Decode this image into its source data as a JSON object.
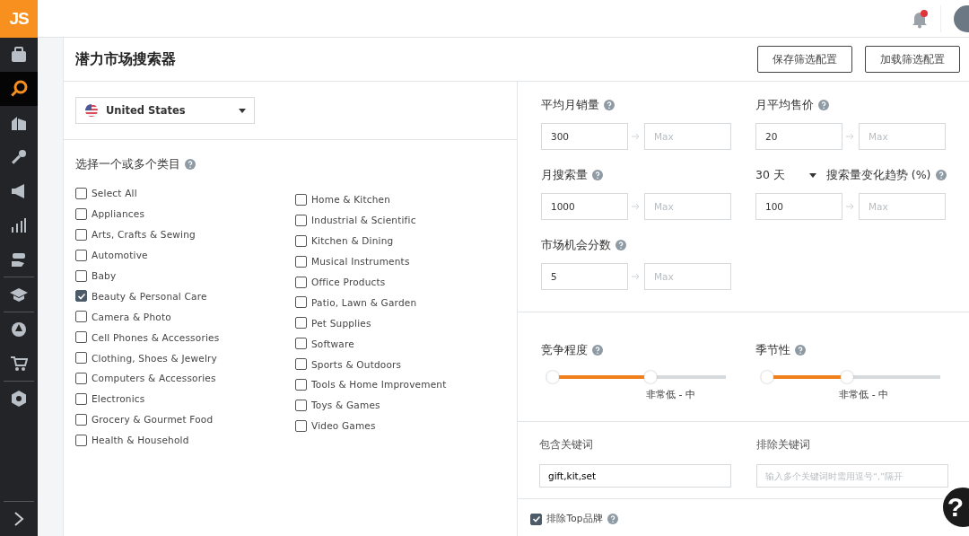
{
  "logo": "JS",
  "sidebar": {
    "items": [
      {
        "kind": "toolbox",
        "selected": false
      },
      {
        "kind": "search",
        "selected": true
      },
      {
        "kind": "building",
        "selected": false
      },
      {
        "kind": "key",
        "selected": false
      },
      {
        "kind": "megaphone",
        "selected": false
      },
      {
        "kind": "chart",
        "selected": false
      },
      {
        "kind": "hand",
        "selected": false
      },
      {
        "kind": "cap",
        "selected": false
      },
      {
        "kind": "aperture",
        "selected": false
      },
      {
        "kind": "cart",
        "selected": false
      },
      {
        "kind": "gear",
        "selected": false
      }
    ]
  },
  "notifications": {
    "unread": true
  },
  "header": {
    "title": "潜力市场搜索器",
    "buttons": [
      "保存筛选配置",
      "加载筛选配置"
    ]
  },
  "country": {
    "value": "United States"
  },
  "categories": {
    "heading": "选择一个或多个类目",
    "columns": [
      [
        {
          "label": "Select All",
          "checked": false
        },
        {
          "label": "Appliances",
          "checked": false
        },
        {
          "label": "Arts, Crafts & Sewing",
          "checked": false
        },
        {
          "label": "Automotive",
          "checked": false
        },
        {
          "label": "Baby",
          "checked": false
        },
        {
          "label": "Beauty & Personal Care",
          "checked": true
        },
        {
          "label": "Camera & Photo",
          "checked": false
        },
        {
          "label": "Cell Phones & Accessories",
          "checked": false
        },
        {
          "label": "Clothing, Shoes & Jewelry",
          "checked": false
        },
        {
          "label": "Computers & Accessories",
          "checked": false
        },
        {
          "label": "Electronics",
          "checked": false
        },
        {
          "label": "Grocery & Gourmet Food",
          "checked": false
        },
        {
          "label": "Health & Household",
          "checked": false
        }
      ],
      [
        {
          "label": "Home & Kitchen",
          "checked": false
        },
        {
          "label": "Industrial & Scientific",
          "checked": false
        },
        {
          "label": "Kitchen & Dining",
          "checked": false
        },
        {
          "label": "Musical Instruments",
          "checked": false
        },
        {
          "label": "Office Products",
          "checked": false
        },
        {
          "label": "Patio, Lawn & Garden",
          "checked": false
        },
        {
          "label": "Pet Supplies",
          "checked": false
        },
        {
          "label": "Software",
          "checked": false
        },
        {
          "label": "Sports & Outdoors",
          "checked": false
        },
        {
          "label": "Tools & Home Improvement",
          "checked": false
        },
        {
          "label": "Toys & Games",
          "checked": false
        },
        {
          "label": "Video Games",
          "checked": false
        }
      ]
    ]
  },
  "ranges": [
    {
      "kind": "plain",
      "label": "平均月销量",
      "min": "300",
      "max_placeholder": "Max"
    },
    {
      "kind": "plain",
      "label": "月平均售价",
      "min": "20",
      "max_placeholder": "Max"
    },
    {
      "kind": "plain",
      "label": "月搜索量",
      "min": "1000",
      "max_placeholder": "Max"
    },
    {
      "kind": "period",
      "period": "30 天",
      "label": "搜索量变化趋势 (%)",
      "min": "100",
      "max_placeholder": "Max"
    },
    {
      "kind": "plain",
      "label": "市场机会分数",
      "min": "5",
      "max_placeholder": "Max"
    }
  ],
  "sliders": [
    {
      "label": "竞争程度",
      "level": 0.58,
      "range": "非常低 - 中"
    },
    {
      "label": "季节性",
      "level": 0.48,
      "range": "非常低 - 中"
    }
  ],
  "keywords": [
    {
      "label": "包含关键词",
      "value": "gift,kit,set"
    },
    {
      "label": "排除关键词",
      "placeholder": "输入多个关键词时需用逗号“,”隔开"
    }
  ],
  "exclude_top_brands": {
    "label": "排除Top品牌",
    "checked": true
  },
  "help_button": "?"
}
